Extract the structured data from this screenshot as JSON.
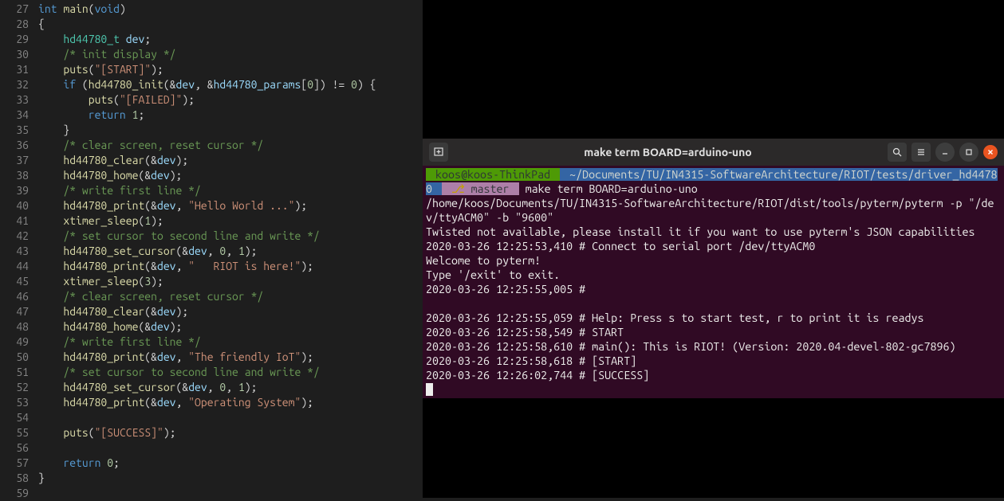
{
  "editor": {
    "firstLine": 27,
    "lines": [
      "int main(void)",
      "{",
      "    hd44780_t dev;",
      "    /* init display */",
      "    puts(\"[START]\");",
      "    if (hd44780_init(&dev, &hd44780_params[0]) != 0) {",
      "        puts(\"[FAILED]\");",
      "        return 1;",
      "    }",
      "    /* clear screen, reset cursor */",
      "    hd44780_clear(&dev);",
      "    hd44780_home(&dev);",
      "    /* write first line */",
      "    hd44780_print(&dev, \"Hello World ...\");",
      "    xtimer_sleep(1);",
      "    /* set cursor to second line and write */",
      "    hd44780_set_cursor(&dev, 0, 1);",
      "    hd44780_print(&dev, \"   RIOT is here!\");",
      "    xtimer_sleep(3);",
      "    /* clear screen, reset cursor */",
      "    hd44780_clear(&dev);",
      "    hd44780_home(&dev);",
      "    /* write first line */",
      "    hd44780_print(&dev, \"The friendly IoT\");",
      "    /* set cursor to second line and write */",
      "    hd44780_set_cursor(&dev, 0, 1);",
      "    hd44780_print(&dev, \"Operating System\");",
      "",
      "    puts(\"[SUCCESS]\");",
      "",
      "    return 0;",
      "}",
      ""
    ]
  },
  "terminal": {
    "title": "make term BOARD=arduino-uno",
    "prompt": {
      "user": "koos@koos-ThinkPad",
      "path": "~/Documents/TU/IN4315-SoftwareArchitecture/RIOT/tests/driver_hd44780",
      "branch": "master",
      "command": "make term BOARD=arduino-uno"
    },
    "output": [
      "/home/koos/Documents/TU/IN4315-SoftwareArchitecture/RIOT/dist/tools/pyterm/pyterm -p \"/dev/ttyACM0\" -b \"9600\"",
      "Twisted not available, please install it if you want to use pyterm's JSON capabilities",
      "2020-03-26 12:25:53,410 # Connect to serial port /dev/ttyACM0",
      "Welcome to pyterm!",
      "Type '/exit' to exit.",
      "2020-03-26 12:25:55,005 # ",
      "",
      "2020-03-26 12:25:55,059 # Help: Press s to start test, r to print it is readys",
      "2020-03-26 12:25:58,549 # START",
      "2020-03-26 12:25:58,610 # main(): This is RIOT! (Version: 2020.04-devel-802-gc7896)",
      "2020-03-26 12:25:58,618 # [START]",
      "2020-03-26 12:26:02,744 # [SUCCESS]"
    ]
  }
}
